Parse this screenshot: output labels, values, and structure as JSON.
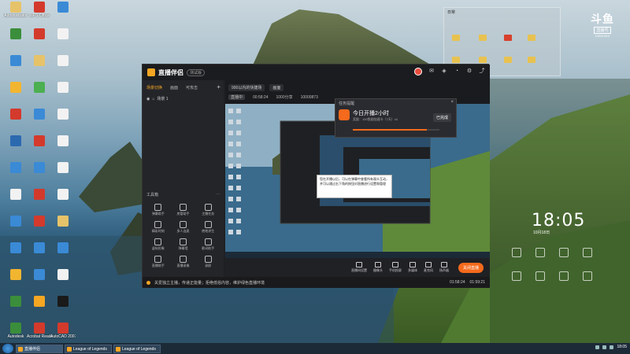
{
  "desktop": {
    "icons": [
      {
        "label": "Administrator",
        "color": "#e6c36a"
      },
      {
        "label": "WPS Office",
        "color": "#d33a2c"
      },
      {
        "label": "",
        "color": "#3a8ad6"
      },
      {
        "label": "",
        "color": "#3b8e3b"
      },
      {
        "label": "",
        "color": "#d33a2c"
      },
      {
        "label": "",
        "color": "#f2f2f2"
      },
      {
        "label": "",
        "color": "#3a8ad6"
      },
      {
        "label": "",
        "color": "#e6c36a"
      },
      {
        "label": "",
        "color": "#f2f2f2"
      },
      {
        "label": "",
        "color": "#f2b530"
      },
      {
        "label": "",
        "color": "#4caf50"
      },
      {
        "label": "",
        "color": "#f2f2f2"
      },
      {
        "label": "",
        "color": "#d33a2c"
      },
      {
        "label": "",
        "color": "#3a8ad6"
      },
      {
        "label": "",
        "color": "#f2f2f2"
      },
      {
        "label": "",
        "color": "#2c6ab0"
      },
      {
        "label": "",
        "color": "#d33a2c"
      },
      {
        "label": "",
        "color": "#f2f2f2"
      },
      {
        "label": "",
        "color": "#3a8ad6"
      },
      {
        "label": "",
        "color": "#3a8ad6"
      },
      {
        "label": "",
        "color": "#f2f2f2"
      },
      {
        "label": "",
        "color": "#f2f2f2"
      },
      {
        "label": "",
        "color": "#d33a2c"
      },
      {
        "label": "",
        "color": "#f2f2f2"
      },
      {
        "label": "",
        "color": "#3a8ad6"
      },
      {
        "label": "",
        "color": "#d33a2c"
      },
      {
        "label": "",
        "color": "#e6c36a"
      },
      {
        "label": "",
        "color": "#3a8ad6"
      },
      {
        "label": "",
        "color": "#3a8ad6"
      },
      {
        "label": "",
        "color": "#3a8ad6"
      },
      {
        "label": "",
        "color": "#f2b530"
      },
      {
        "label": "",
        "color": "#3a8ad6"
      },
      {
        "label": "",
        "color": "#f2f2f2"
      },
      {
        "label": "",
        "color": "#3b8e3b"
      },
      {
        "label": "",
        "color": "#f5a623"
      },
      {
        "label": "",
        "color": "#1a1a1a"
      },
      {
        "label": "Autodesk",
        "color": "#3b8e3b"
      },
      {
        "label": "Acrobat Reader DC",
        "color": "#d33a2c"
      },
      {
        "label": "AutoCAD 2007",
        "color": "#d33a2c"
      }
    ]
  },
  "brand": {
    "main": "斗鱼",
    "badge": "直播号",
    "sub": "100014XX"
  },
  "explorer": {
    "title": "日常"
  },
  "clock": {
    "time": "18:05",
    "date": "10月18日"
  },
  "app": {
    "title": "直播伴侣",
    "badge": "测试版",
    "left_tabs": [
      "场景切换",
      "画面",
      "可攻击"
    ],
    "scene_item": "场景 1",
    "tools_title": "工具箱",
    "tools": [
      "弹幕助手",
      "房管助手",
      "主播任务",
      "精彩时刻",
      "多人连麦",
      "绝地求生",
      "虚拟形象",
      "弹幕墙",
      "歌词助手",
      "直播助手",
      "直播录像",
      "录屏"
    ],
    "scene_tabs": [
      "900以内的快捷场",
      "画面"
    ],
    "status_items": [
      "直播中",
      "00:58:24",
      "1000分享",
      "10000873"
    ],
    "bottom_tools": [
      "直播间设置",
      "摄像头",
      "手机投屏",
      "多媒体",
      "麦克风",
      "扬声器"
    ],
    "live_button": "关闭直播",
    "tip": "关爱独立主播，传递正能量；拒绝低俗内容，维护绿色直播环境",
    "tip_times": [
      "01:58:24",
      "01:59:21"
    ]
  },
  "popup": {
    "title": "任务提醒",
    "headline": "今日开播2小时",
    "sub": "奖励：100鱼翅加速卡（7天）x1",
    "button": "已完成",
    "progress": 0.85
  },
  "tooltip": {
    "text": "您在开播以后，可以在弹幕中查看所有观众互动，并可以通过右下角的按钮对直播进行设置和管理"
  },
  "taskbar": {
    "tasks": [
      "直播伴侣",
      "League of Legends",
      "League of Legends"
    ],
    "tray_time": "18:05"
  }
}
